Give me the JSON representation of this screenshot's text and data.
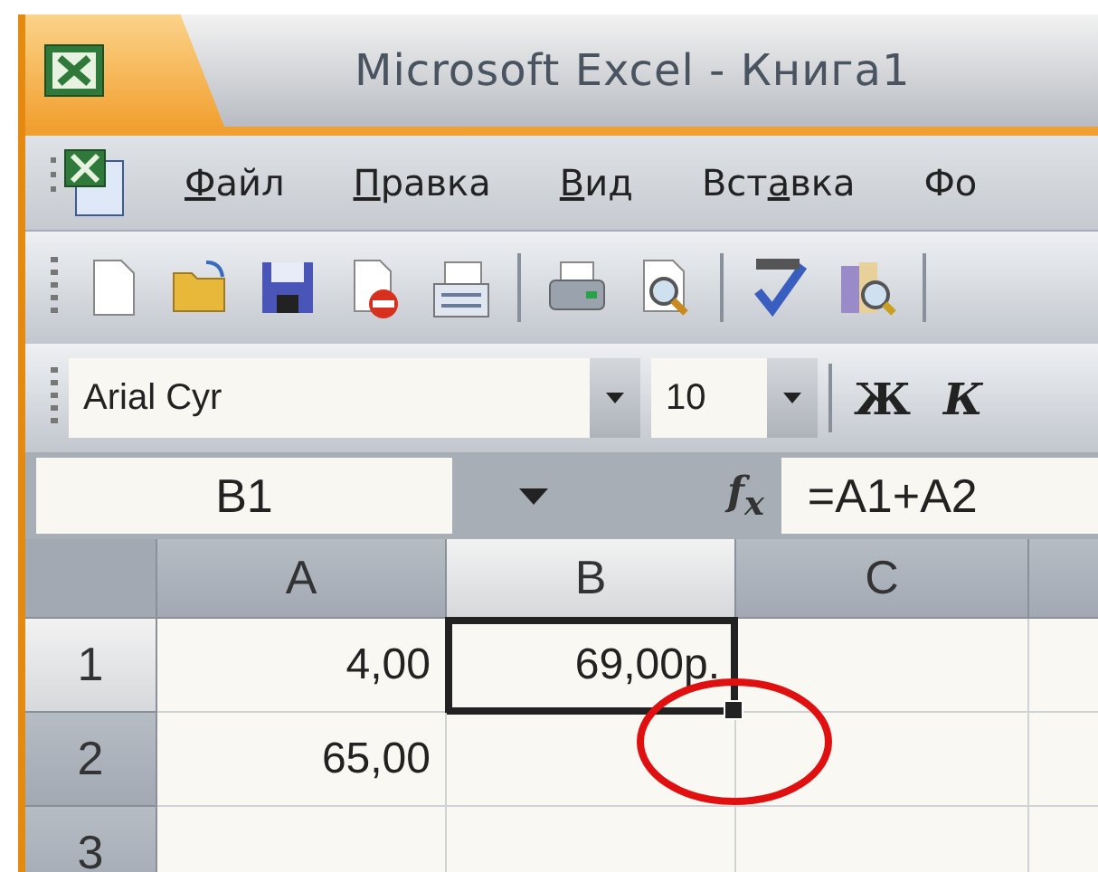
{
  "window": {
    "title": "Microsoft Excel - Книга1"
  },
  "menu": [
    {
      "key": "Ф",
      "after": "айл"
    },
    {
      "key": "П",
      "after": "равка"
    },
    {
      "key": "В",
      "after": "ид"
    },
    {
      "before": "Вст",
      "key": "а",
      "after": "вка"
    },
    {
      "before": "Фо"
    }
  ],
  "format_toolbar": {
    "font": "Arial Cyr",
    "size": "10",
    "bold": "Ж",
    "italic": "К"
  },
  "formula_bar": {
    "name_box": "B1",
    "function_label": "f$_{x}$",
    "formula": "=A1+A2"
  },
  "sheet": {
    "columns": [
      {
        "label": "A",
        "selected": false
      },
      {
        "label": "B",
        "selected": true
      },
      {
        "label": "C",
        "selected": false
      }
    ],
    "rows": [
      {
        "label": "1",
        "selected": true,
        "cells": [
          {
            "value": "4,00",
            "active": false
          },
          {
            "value": "69,00р.",
            "active": true
          },
          {
            "active": false
          }
        ]
      },
      {
        "label": "2",
        "selected": false,
        "cells": [
          {
            "value": "65,00",
            "active": false
          },
          {
            "active": false
          },
          {
            "active": false
          }
        ]
      },
      {
        "label": "3",
        "selected": false,
        "cells": [
          {
            "active": false
          },
          {
            "active": false
          },
          {
            "active": false
          }
        ]
      }
    ]
  },
  "annotation": {
    "kind": "circle"
  }
}
